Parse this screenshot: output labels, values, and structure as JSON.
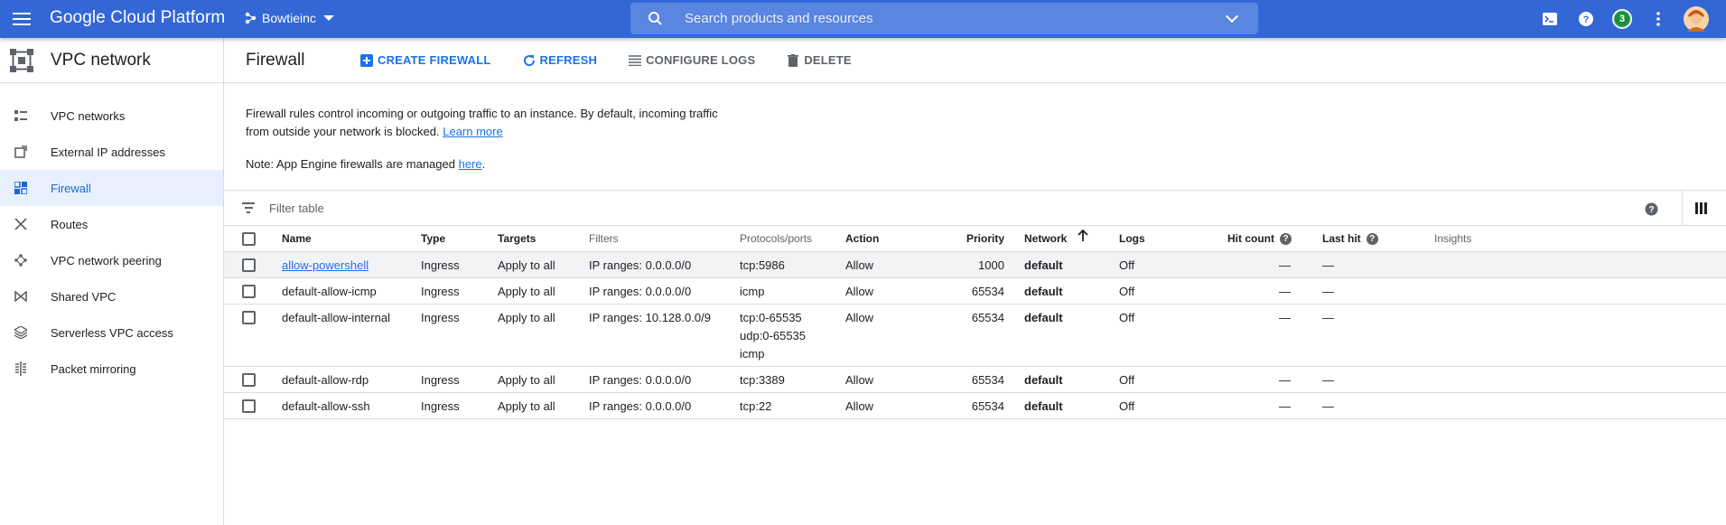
{
  "topbar": {
    "brand": "Google Cloud Platform",
    "project": "Bowtieinc",
    "search_placeholder": "Search products and resources",
    "notification_count": "3"
  },
  "sidebar": {
    "title": "VPC network",
    "items": [
      {
        "label": "VPC networks",
        "icon": "vpc-networks-icon"
      },
      {
        "label": "External IP addresses",
        "icon": "external-ip-icon"
      },
      {
        "label": "Firewall",
        "icon": "firewall-icon",
        "active": true
      },
      {
        "label": "Routes",
        "icon": "routes-icon"
      },
      {
        "label": "VPC network peering",
        "icon": "peering-icon"
      },
      {
        "label": "Shared VPC",
        "icon": "shared-vpc-icon"
      },
      {
        "label": "Serverless VPC access",
        "icon": "serverless-icon"
      },
      {
        "label": "Packet mirroring",
        "icon": "packet-mirroring-icon"
      }
    ]
  },
  "page": {
    "title": "Firewall",
    "actions": {
      "create": "CREATE FIREWALL",
      "refresh": "REFRESH",
      "configure_logs": "CONFIGURE LOGS",
      "delete": "DELETE"
    },
    "info_text": "Firewall rules control incoming or outgoing traffic to an instance. By default, incoming traffic from outside your network is blocked.",
    "learn_more": "Learn more",
    "note_prefix": "Note: App Engine firewalls are managed",
    "note_link": "here",
    "note_suffix": ".",
    "filter_placeholder": "Filter table"
  },
  "table": {
    "columns": {
      "name": "Name",
      "type": "Type",
      "targets": "Targets",
      "filters": "Filters",
      "protocols": "Protocols/ports",
      "action": "Action",
      "priority": "Priority",
      "network": "Network",
      "logs": "Logs",
      "hit_count": "Hit count",
      "last_hit": "Last hit",
      "insights": "Insights"
    },
    "rows": [
      {
        "name": "allow-powershell",
        "type": "Ingress",
        "targets": "Apply to all",
        "filters": "IP ranges: 0.0.0.0/0",
        "protocols": [
          "tcp:5986"
        ],
        "action": "Allow",
        "priority": "1000",
        "network": "default",
        "logs": "Off",
        "hit_count": "—",
        "last_hit": "—"
      },
      {
        "name": "default-allow-icmp",
        "type": "Ingress",
        "targets": "Apply to all",
        "filters": "IP ranges: 0.0.0.0/0",
        "protocols": [
          "icmp"
        ],
        "action": "Allow",
        "priority": "65534",
        "network": "default",
        "logs": "Off",
        "hit_count": "—",
        "last_hit": "—"
      },
      {
        "name": "default-allow-internal",
        "type": "Ingress",
        "targets": "Apply to all",
        "filters": "IP ranges: 10.128.0.0/9",
        "protocols": [
          "tcp:0-65535",
          "udp:0-65535",
          "icmp"
        ],
        "action": "Allow",
        "priority": "65534",
        "network": "default",
        "logs": "Off",
        "hit_count": "—",
        "last_hit": "—"
      },
      {
        "name": "default-allow-rdp",
        "type": "Ingress",
        "targets": "Apply to all",
        "filters": "IP ranges: 0.0.0.0/0",
        "protocols": [
          "tcp:3389"
        ],
        "action": "Allow",
        "priority": "65534",
        "network": "default",
        "logs": "Off",
        "hit_count": "—",
        "last_hit": "—"
      },
      {
        "name": "default-allow-ssh",
        "type": "Ingress",
        "targets": "Apply to all",
        "filters": "IP ranges: 0.0.0.0/0",
        "protocols": [
          "tcp:22"
        ],
        "action": "Allow",
        "priority": "65534",
        "network": "default",
        "logs": "Off",
        "hit_count": "—",
        "last_hit": "—"
      }
    ]
  },
  "colors": {
    "topbar": "#3367d6",
    "accent": "#1a73e8",
    "active_bg": "#e8f0fe"
  }
}
